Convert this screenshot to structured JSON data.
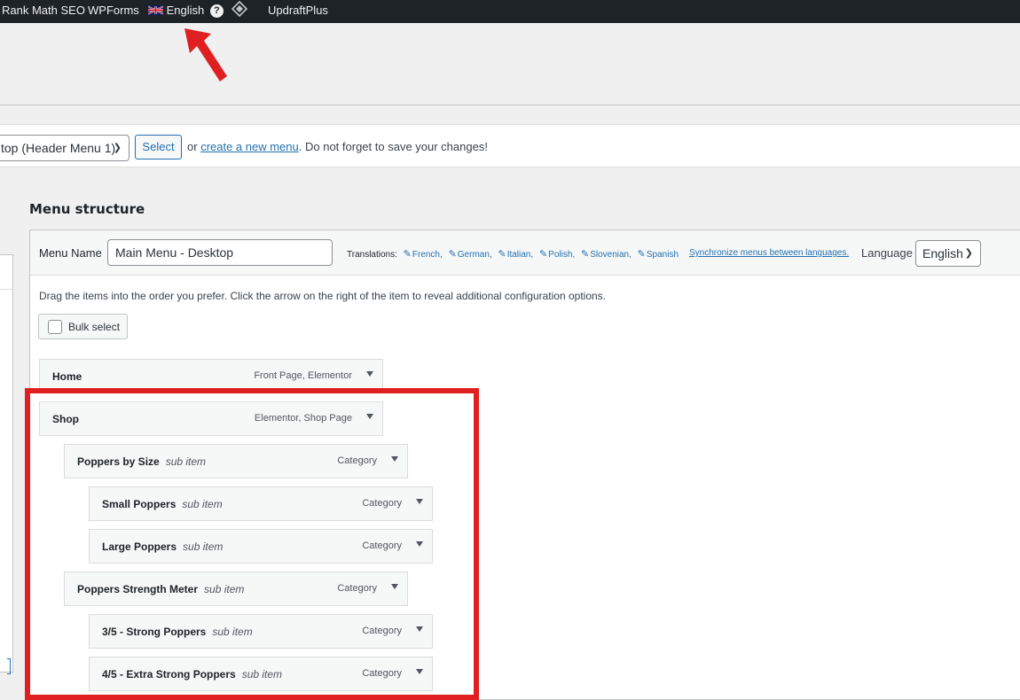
{
  "adminbar": {
    "items": [
      "Rank Math SEO",
      "WPForms"
    ],
    "language": "English",
    "help_glyph": "?",
    "last_item": "UpdraftPlus",
    "icons": [
      "uk-flag-icon",
      "help-icon",
      "diamond-logo-icon"
    ]
  },
  "manage": {
    "menu_select_value": "top (Header Menu 1)",
    "select_button": "Select",
    "text_prefix": "or",
    "create_link": "create a new menu",
    "text_suffix": ". Do not forget to save your changes!"
  },
  "heading": "Menu structure",
  "editor": {
    "menu_name_label": "Menu Name",
    "menu_name_value": "Main Menu - Desktop",
    "translations_label": "Translations:",
    "translations": [
      "French",
      "German",
      "Italian",
      "Polish",
      "Slovenian",
      "Spanish"
    ],
    "sync_link": "Synchronize menus between languages.",
    "language_label": "Language",
    "language_value": "English",
    "instructions": "Drag the items into the order you prefer. Click the arrow on the right of the item to reveal additional configuration options.",
    "bulk_select": "Bulk select"
  },
  "menu_items": [
    {
      "title": "Home",
      "sub": "",
      "type": "Front Page, Elementor"
    },
    {
      "title": "Shop",
      "sub": "",
      "type": "Elementor, Shop Page"
    },
    {
      "title": "Poppers by Size",
      "sub": "sub item",
      "type": "Category"
    },
    {
      "title": "Small Poppers",
      "sub": "sub item",
      "type": "Category"
    },
    {
      "title": "Large Poppers",
      "sub": "sub item",
      "type": "Category"
    },
    {
      "title": "Poppers Strength Meter",
      "sub": "sub item",
      "type": "Category"
    },
    {
      "title": "3/5 - Strong Poppers",
      "sub": "sub item",
      "type": "Category"
    },
    {
      "title": "4/5 - Extra Strong Poppers",
      "sub": "sub item",
      "type": "Category"
    }
  ],
  "colors": {
    "adminbar": "#1d2327",
    "link": "#2271b1",
    "annotation": "#e02020"
  }
}
